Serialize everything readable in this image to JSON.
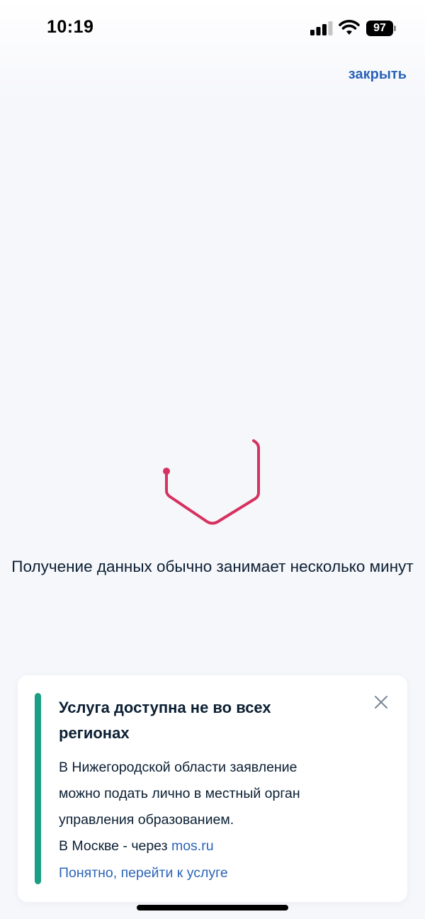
{
  "status_bar": {
    "time": "10:19",
    "battery_level": "97",
    "icons": [
      "signal-icon",
      "wifi-icon",
      "battery-icon"
    ]
  },
  "header": {
    "close_label": "закрыть"
  },
  "loader": {
    "icon": "spinner-icon",
    "message": "Получение данных обычно занимает несколько минут"
  },
  "notice": {
    "title": "Услуга доступна не во всех регионах",
    "body_lines": [
      "В Нижегородской области заявление",
      "можно подать лично в местный орган",
      "управления образованием."
    ],
    "moscow_prefix": "В Москве - через ",
    "moscow_link": "mos.ru",
    "action_label": "Понятно, перейти к услуге",
    "icons": [
      "close-icon"
    ]
  },
  "colors": {
    "accent": "#2b64b8",
    "spinner": "#d6325f",
    "notice_stripe": "#1a9e84",
    "text": "#0b1f33"
  }
}
